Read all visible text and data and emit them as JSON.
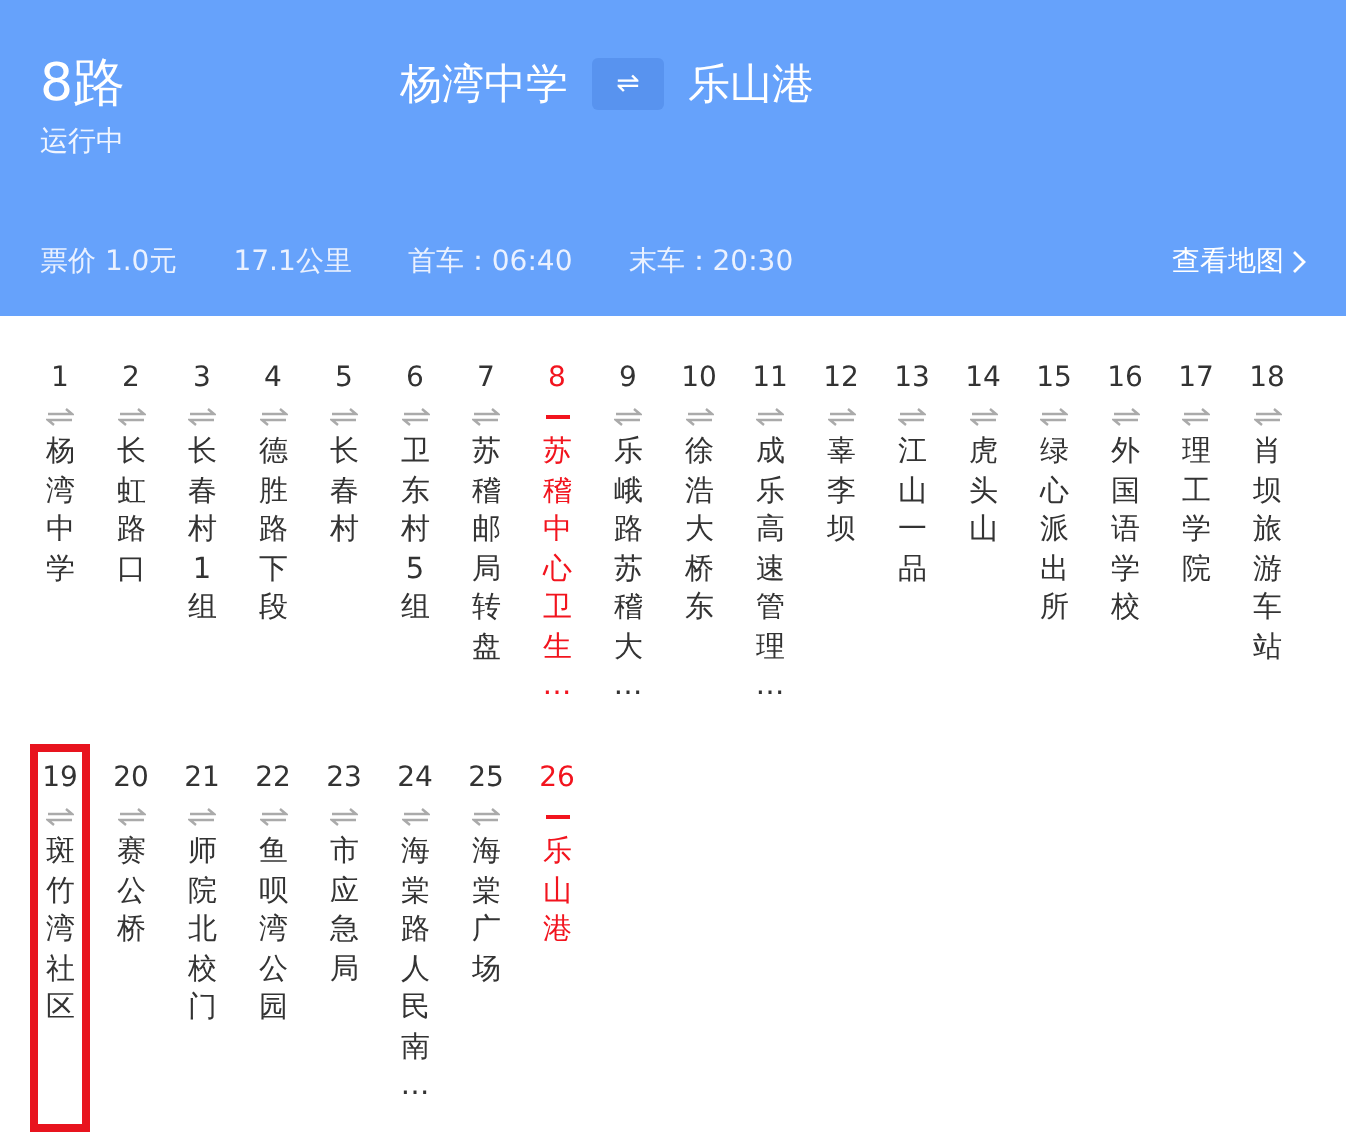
{
  "header": {
    "route": "8路",
    "status": "运行中",
    "from": "杨湾中学",
    "swap": "⇌",
    "to": "乐山港",
    "info": [
      "票价 1.0元",
      "17.1公里",
      "首车：06:40",
      "末车：20:30"
    ],
    "map_link": "查看地图"
  },
  "stops": [
    {
      "number": "1",
      "name": "杨湾中学",
      "kind": "both",
      "highlighted": false,
      "selected": false
    },
    {
      "number": "2",
      "name": "长虹路口",
      "kind": "both",
      "highlighted": false,
      "selected": false
    },
    {
      "number": "3",
      "name": "长春村1组",
      "kind": "both",
      "highlighted": false,
      "selected": false
    },
    {
      "number": "4",
      "name": "德胜路下段",
      "kind": "both",
      "highlighted": false,
      "selected": false
    },
    {
      "number": "5",
      "name": "长春村",
      "kind": "both",
      "highlighted": false,
      "selected": false
    },
    {
      "number": "6",
      "name": "卫东村5组",
      "kind": "both",
      "highlighted": false,
      "selected": false
    },
    {
      "number": "7",
      "name": "苏稽邮局转盘",
      "kind": "both",
      "highlighted": false,
      "selected": false
    },
    {
      "number": "8",
      "name": "苏稽中心卫生…",
      "kind": "single",
      "highlighted": true,
      "selected": false
    },
    {
      "number": "9",
      "name": "乐峨路苏稽大…",
      "kind": "both",
      "highlighted": false,
      "selected": false
    },
    {
      "number": "10",
      "name": "徐浩大桥东",
      "kind": "both",
      "highlighted": false,
      "selected": false
    },
    {
      "number": "11",
      "name": "成乐高速管理…",
      "kind": "both",
      "highlighted": false,
      "selected": false
    },
    {
      "number": "12",
      "name": "辜李坝",
      "kind": "both",
      "highlighted": false,
      "selected": false
    },
    {
      "number": "13",
      "name": "江山一品",
      "kind": "both",
      "highlighted": false,
      "selected": false
    },
    {
      "number": "14",
      "name": "虎头山",
      "kind": "both",
      "highlighted": false,
      "selected": false
    },
    {
      "number": "15",
      "name": "绿心派出所",
      "kind": "both",
      "highlighted": false,
      "selected": false
    },
    {
      "number": "16",
      "name": "外国语学校",
      "kind": "both",
      "highlighted": false,
      "selected": false
    },
    {
      "number": "17",
      "name": "理工学院",
      "kind": "both",
      "highlighted": false,
      "selected": false
    },
    {
      "number": "18",
      "name": "肖坝旅游车站",
      "kind": "both",
      "highlighted": false,
      "selected": false
    },
    {
      "number": "19",
      "name": "斑竹湾社区",
      "kind": "both",
      "highlighted": false,
      "selected": true
    },
    {
      "number": "20",
      "name": "赛公桥",
      "kind": "both",
      "highlighted": false,
      "selected": false
    },
    {
      "number": "21",
      "name": "师院北校门",
      "kind": "both",
      "highlighted": false,
      "selected": false
    },
    {
      "number": "22",
      "name": "鱼呗湾公园",
      "kind": "both",
      "highlighted": false,
      "selected": false
    },
    {
      "number": "23",
      "name": "市应急局",
      "kind": "both",
      "highlighted": false,
      "selected": false
    },
    {
      "number": "24",
      "name": "海棠路人民南…",
      "kind": "both",
      "highlighted": false,
      "selected": false
    },
    {
      "number": "25",
      "name": "海棠广场",
      "kind": "both",
      "highlighted": false,
      "selected": false
    },
    {
      "number": "26",
      "name": "乐山港",
      "kind": "single",
      "highlighted": true,
      "selected": false
    }
  ]
}
